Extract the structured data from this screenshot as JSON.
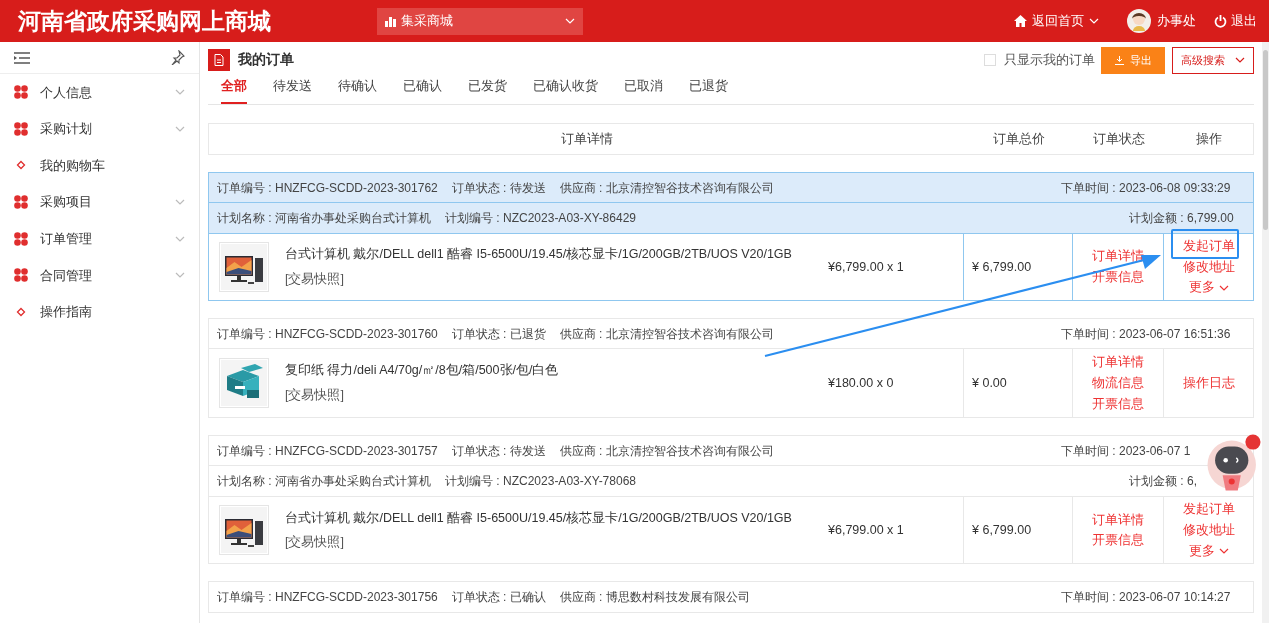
{
  "header": {
    "title": "河南省政府采购网上商城",
    "mall_select": "集采商城",
    "home_link": "返回首页",
    "user": "办事处",
    "logout": "退出"
  },
  "sidebar": {
    "items": [
      {
        "kind": "group",
        "label": "个人信息"
      },
      {
        "kind": "group",
        "label": "采购计划"
      },
      {
        "kind": "link",
        "label": "我的购物车"
      },
      {
        "kind": "group",
        "label": "采购项目"
      },
      {
        "kind": "group",
        "label": "订单管理"
      },
      {
        "kind": "group",
        "label": "合同管理"
      },
      {
        "kind": "link",
        "label": "操作指南"
      }
    ]
  },
  "page": {
    "title": "我的订单",
    "only_mine": {
      "label": "只显示我的订单",
      "checked": false
    },
    "export_button": "导出",
    "advanced_search": "高级搜索"
  },
  "tabs": [
    {
      "label": "全部",
      "selected": true
    },
    {
      "label": "待发送",
      "selected": false
    },
    {
      "label": "待确认",
      "selected": false
    },
    {
      "label": "已确认",
      "selected": false
    },
    {
      "label": "已发货",
      "selected": false
    },
    {
      "label": "已确认收货",
      "selected": false
    },
    {
      "label": "已取消",
      "selected": false
    },
    {
      "label": "已退货",
      "selected": false
    }
  ],
  "table": {
    "columns": [
      "订单详情",
      "订单总价",
      "订单状态",
      "操作"
    ]
  },
  "orders": [
    {
      "selected": true,
      "info": "订单编号 : HNZFCG-SCDD-2023-301762",
      "status": "订单状态 : 待发送",
      "supplier": "供应商 : 北京清控智谷技术咨询有限公司",
      "time": "下单时间 : 2023-06-08 09:33:29",
      "plan": {
        "name": "计划名称 : 河南省办事处采购台式计算机",
        "code": "计划编号 : NZC2023-A03-XY-86429",
        "amount": "计划金额 : 6,799.00"
      },
      "item": {
        "name": "台式计算机 戴尔/DELL dell1 酷睿 I5-6500U/19.45/核芯显卡/1G/200GB/2TB/UOS V20/1GB",
        "snapshot": "[交易快照]",
        "unit": "¥6,799.00 x 1",
        "total": "¥ 6,799.00"
      },
      "actions": [
        {
          "kind": "link",
          "label": "订单详情"
        },
        {
          "kind": "link",
          "label": "开票信息"
        }
      ],
      "operations": [
        {
          "kind": "link",
          "label": "发起订单"
        },
        {
          "kind": "link",
          "label": "修改地址"
        },
        {
          "kind": "dropdown",
          "label": "更多"
        }
      ]
    },
    {
      "selected": false,
      "info": "订单编号 : HNZFCG-SCDD-2023-301760",
      "status": "订单状态 : 已退货",
      "supplier": "供应商 : 北京清控智谷技术咨询有限公司",
      "time": "下单时间 : 2023-06-07 16:51:36",
      "item": {
        "name": "复印纸 得力/deli A4/70g/㎡/8包/箱/500张/包/白色",
        "snapshot": "[交易快照]",
        "unit": "¥180.00 x 0",
        "total": "¥ 0.00"
      },
      "actions": [
        {
          "kind": "link",
          "label": "订单详情"
        },
        {
          "kind": "link",
          "label": "物流信息"
        },
        {
          "kind": "link",
          "label": "开票信息"
        }
      ],
      "operations": [
        {
          "kind": "link",
          "label": "操作日志"
        }
      ]
    },
    {
      "selected": false,
      "info": "订单编号 : HNZFCG-SCDD-2023-301757",
      "status": "订单状态 : 待发送",
      "supplier": "供应商 : 北京清控智谷技术咨询有限公司",
      "time": "下单时间 : 2023-06-07 1",
      "plan": {
        "name": "计划名称 : 河南省办事处采购台式计算机",
        "code": "计划编号 : NZC2023-A03-XY-78068",
        "amount": "计划金额 : 6,"
      },
      "item": {
        "name": "台式计算机 戴尔/DELL dell1 酷睿 I5-6500U/19.45/核芯显卡/1G/200GB/2TB/UOS V20/1GB",
        "snapshot": "[交易快照]",
        "unit": "¥6,799.00 x 1",
        "total": "¥ 6,799.00"
      },
      "actions": [
        {
          "kind": "link",
          "label": "订单详情"
        },
        {
          "kind": "link",
          "label": "开票信息"
        }
      ],
      "operations": [
        {
          "kind": "link",
          "label": "发起订单"
        },
        {
          "kind": "link",
          "label": "修改地址"
        },
        {
          "kind": "dropdown",
          "label": "更多"
        }
      ]
    },
    {
      "selected": false,
      "info": "订单编号 : HNZFCG-SCDD-2023-301756",
      "status": "订单状态 : 已确认",
      "supplier": "供应商 : 博思数村科技发展有限公司",
      "time": "下单时间 : 2023-06-07 10:14:27"
    }
  ]
}
